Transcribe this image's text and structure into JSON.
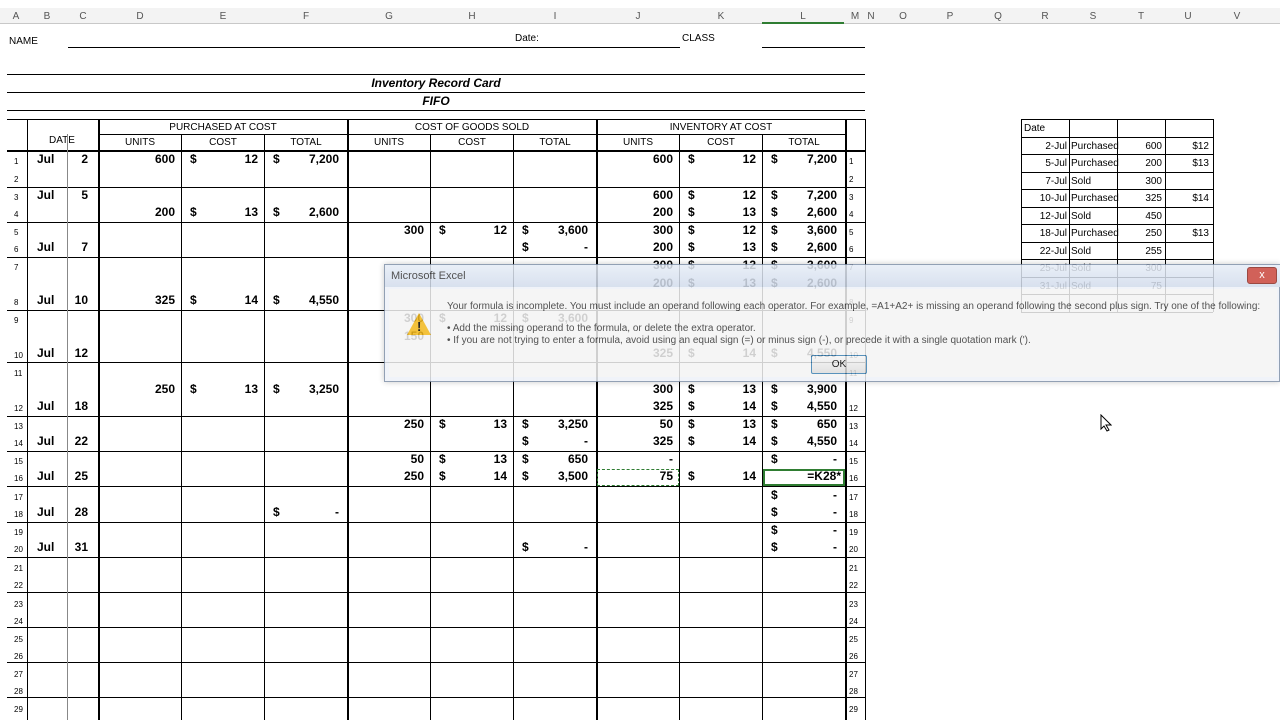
{
  "sheet": {
    "col_letters": [
      "A",
      "B",
      "C",
      "D",
      "E",
      "F",
      "G",
      "H",
      "I",
      "J",
      "K",
      "L",
      "M",
      "N",
      "O",
      "P",
      "Q",
      "R",
      "S",
      "T",
      "U",
      "V"
    ],
    "name_label": "NAME",
    "date_label": "Date:",
    "class_label": "CLASS",
    "card_title": "Inventory Record Card",
    "card_subtitle": "FIFO",
    "group_headers": [
      "PURCHASED AT COST",
      "COST OF GOODS SOLD",
      "INVENTORY AT COST"
    ],
    "date_header": "DATE",
    "sub_headers": [
      "UNITS",
      "COST",
      "TOTAL",
      "UNITS",
      "COST",
      "TOTAL",
      "UNITS",
      "COST",
      "TOTAL"
    ],
    "row_numbers": [
      "1",
      "2",
      "3",
      "4",
      "5",
      "6",
      "7",
      "8",
      "9",
      "10",
      "11",
      "12",
      "13",
      "14",
      "15",
      "16",
      "17",
      "18",
      "19",
      "20",
      "21",
      "22",
      "23",
      "24",
      "25",
      "26",
      "27",
      "28",
      "29"
    ],
    "entries": [
      {
        "month": "Jul",
        "day": "2"
      },
      {
        "month": "Jul",
        "day": "5"
      },
      {
        "month": "Jul",
        "day": "7"
      },
      {
        "month": "Jul",
        "day": "10"
      },
      {
        "month": "Jul",
        "day": "12"
      },
      {
        "month": "Jul",
        "day": "18"
      },
      {
        "month": "Jul",
        "day": "22"
      },
      {
        "month": "Jul",
        "day": "25"
      },
      {
        "month": "Jul",
        "day": "28"
      },
      {
        "month": "Jul",
        "day": "31"
      }
    ],
    "purchases": [
      {
        "units": "600",
        "cost": "12",
        "total": "7,200"
      },
      {
        "units": "200",
        "cost": "13",
        "total": "2,600"
      },
      {
        "units": "325",
        "cost": "14",
        "total": "4,550"
      },
      {
        "units": "250",
        "cost": "13",
        "total": "3,250"
      },
      {
        "total": "-"
      }
    ],
    "cogs": [
      {
        "units": "300",
        "cost": "12",
        "total": "3,600"
      },
      {
        "total": "-"
      },
      {
        "units": "300",
        "cost": "12",
        "total": "3,600"
      },
      {
        "units": "150"
      },
      {
        "units": "250",
        "cost": "13",
        "total": "3,250"
      },
      {
        "total": "-"
      },
      {
        "units": "50",
        "cost": "13",
        "total": "650"
      },
      {
        "units": "250",
        "cost": "14",
        "total": "3,500"
      },
      {
        "total": "-"
      }
    ],
    "inventory": [
      {
        "units": "600",
        "cost": "12",
        "total": "7,200"
      },
      {
        "units": "600",
        "cost": "12",
        "total": "7,200"
      },
      {
        "units": "200",
        "cost": "13",
        "total": "2,600"
      },
      {
        "units": "300",
        "cost": "12",
        "total": "3,600"
      },
      {
        "units": "200",
        "cost": "13",
        "total": "2,600"
      },
      {
        "units": "300",
        "cost": "12",
        "total": "3,600"
      },
      {
        "units": "200",
        "cost": "13",
        "total": "2,600"
      },
      {
        "units": "325",
        "cost": "14",
        "total": "4,550"
      },
      {
        "total": "650"
      },
      {
        "units": "325",
        "cost": "14",
        "total": "4,550"
      },
      {
        "units": "300",
        "cost": "13",
        "total": "3,900"
      },
      {
        "units": "325",
        "cost": "14",
        "total": "4,550"
      },
      {
        "units": "50",
        "cost": "13",
        "total": "650"
      },
      {
        "units": "325",
        "cost": "14",
        "total": "4,550"
      },
      {
        "units": "-",
        "total": "-"
      },
      {
        "units": "75",
        "cost": "14",
        "formula": "=K28*"
      },
      {
        "total": "-"
      },
      {
        "total": "-"
      },
      {
        "total": "-"
      },
      {
        "total": "-"
      }
    ],
    "dollar": "$"
  },
  "side_table": {
    "header": "Date",
    "rows": [
      {
        "date": "2-Jul",
        "type": "Purchased",
        "qty": "600",
        "price": "$12"
      },
      {
        "date": "5-Jul",
        "type": "Purchased",
        "qty": "200",
        "price": "$13"
      },
      {
        "date": "7-Jul",
        "type": "Sold",
        "qty": "300",
        "price": ""
      },
      {
        "date": "10-Jul",
        "type": "Purchased",
        "qty": "325",
        "price": "$14"
      },
      {
        "date": "12-Jul",
        "type": "Sold",
        "qty": "450",
        "price": ""
      },
      {
        "date": "18-Jul",
        "type": "Purchased",
        "qty": "250",
        "price": "$13"
      },
      {
        "date": "22-Jul",
        "type": "Sold",
        "qty": "255",
        "price": ""
      },
      {
        "date": "25-Jul",
        "type": "Sold",
        "qty": "300",
        "price": ""
      },
      {
        "date": "31-Jul",
        "type": "Sold",
        "qty": "75",
        "price": ""
      }
    ]
  },
  "dialog": {
    "title": "Microsoft Excel",
    "close_glyph": "x",
    "message": "Your formula is incomplete. You must include an operand following each operator. For example, =A1+A2+ is missing an operand following the second plus sign. Try one of the following:",
    "bullet1": "• Add the missing operand to the formula, or delete the extra operator.",
    "bullet2": "• If you are not trying to enter a formula, avoid using an equal sign (=) or minus sign (-), or precede it with a single quotation mark (').",
    "ok_label": "OK",
    "icon": "warning-icon"
  }
}
